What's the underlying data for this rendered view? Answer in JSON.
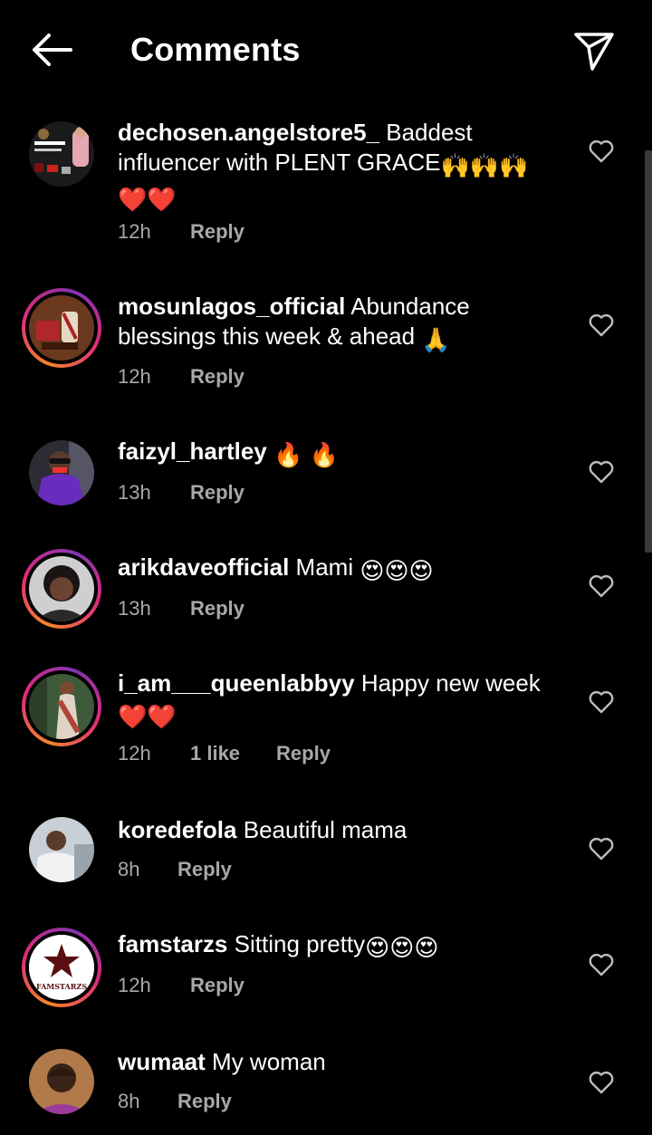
{
  "header": {
    "title": "Comments",
    "back_icon": "arrow-left-icon",
    "share_icon": "paper-plane-icon"
  },
  "colors": {
    "background": "#000000",
    "text": "#ffffff",
    "meta": "#a8a8a8",
    "heart_red": "#e0162b",
    "story_ring": [
      "#f58529",
      "#dd2a7b",
      "#8134af"
    ]
  },
  "comments": [
    {
      "username": "dechosen.angelstore5_",
      "text": "Baddest influencer with PLENT GRACE",
      "emoji_line1": "🙌🙌🙌",
      "emoji_line2": "❤️❤️",
      "time": "12h",
      "likes": "",
      "reply": "Reply",
      "story_ring": false
    },
    {
      "username": "mosunlagos_official",
      "text": "Abundance blessings this week & ahead",
      "emoji": "🙏",
      "time": "12h",
      "likes": "",
      "reply": "Reply",
      "story_ring": true
    },
    {
      "username": "faizyl_hartley",
      "text": "",
      "emoji": "🔥 🔥",
      "time": "13h",
      "likes": "",
      "reply": "Reply",
      "story_ring": false
    },
    {
      "username": "arikdaveofficial",
      "text": "Mami",
      "emoji": "😍😍😍",
      "time": "13h",
      "likes": "",
      "reply": "Reply",
      "story_ring": true
    },
    {
      "username": "i_am___queenlabbyy",
      "text": "Happy new week",
      "emoji": "❤️❤️",
      "time": "12h",
      "likes": "1 like",
      "reply": "Reply",
      "story_ring": true
    },
    {
      "username": "koredefola",
      "text": "Beautiful mama",
      "emoji": "",
      "time": "8h",
      "likes": "",
      "reply": "Reply",
      "story_ring": false
    },
    {
      "username": "famstarzs",
      "text": "Sitting pretty",
      "emoji": "😍😍😍",
      "time": "12h",
      "likes": "",
      "reply": "Reply",
      "story_ring": true,
      "avatar_logo_text": "FAMSTARZS"
    },
    {
      "username": "wumaat",
      "text": "My woman",
      "emoji": "",
      "time": "8h",
      "likes": "",
      "reply": "Reply",
      "story_ring": false
    }
  ]
}
